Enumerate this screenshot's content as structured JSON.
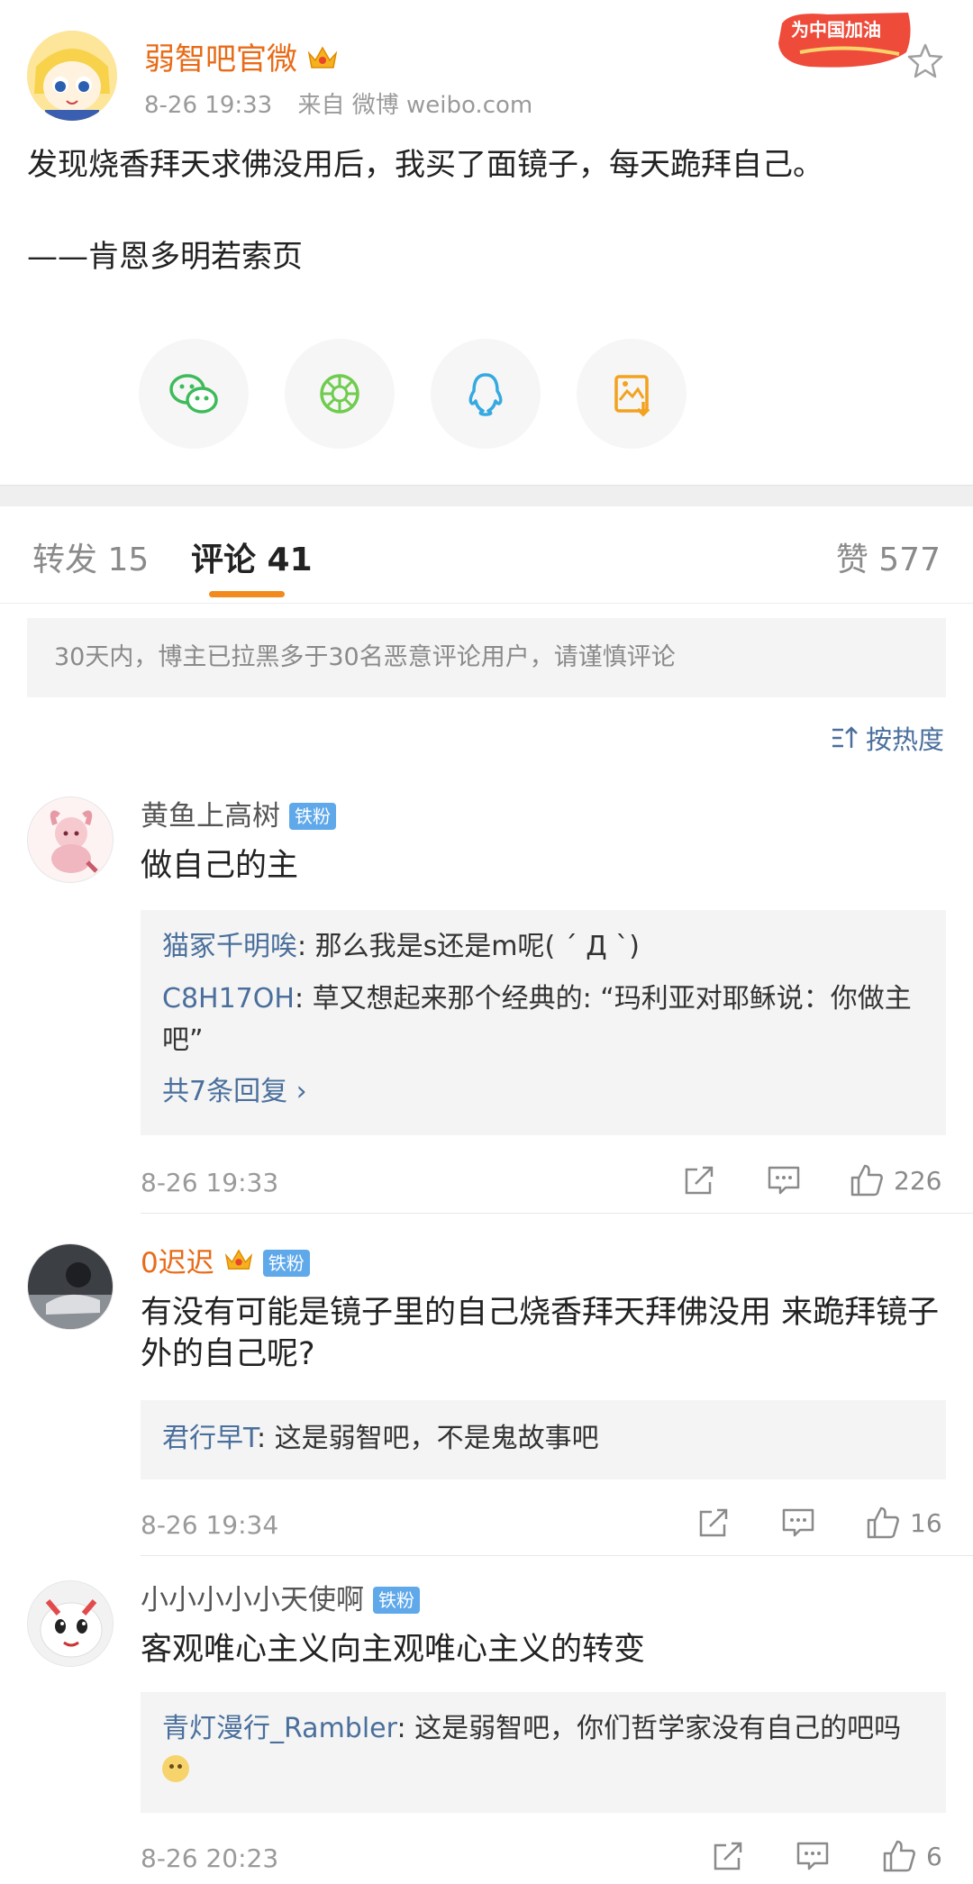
{
  "post": {
    "author": "弱智吧官微",
    "time": "8-26 19:33",
    "source": "来自 微博 weibo.com",
    "promo_text": "为中国加油",
    "text": "发现烧香拜天求佛没用后，我买了面镜子，每天跪拜自己。",
    "signature": "——肯恩多明若索页",
    "share_icons": [
      "wechat-icon",
      "moments-icon",
      "qq-icon",
      "save-image-icon"
    ]
  },
  "tabs": {
    "repost": "转发 15",
    "comment": "评论 41",
    "like": "赞 577"
  },
  "notice": "30天内，博主已拉黑多于30名恶意评论用户，请谨慎评论",
  "sort_label": "按热度",
  "comments": [
    {
      "name": "黄鱼上高树",
      "badge": "铁粉",
      "text": "做自己的主",
      "replies": [
        {
          "name": "猫冢千明唉",
          "text": ": 那么我是s还是m呢(  ´ Д `)"
        },
        {
          "name": "C8H17OH",
          "text": ": 草又想起来那个经典的: “玛利亚对耶稣说：你做主吧”"
        }
      ],
      "more": "共7条回复 ›",
      "time": "8-26 19:33",
      "likes": "226"
    },
    {
      "name": "0迟迟",
      "badge": "铁粉",
      "text": "有没有可能是镜子里的自己烧香拜天拜佛没用 来跪拜镜子外的自己呢?",
      "replies": [
        {
          "name": "君行早T",
          "text": ": 这是弱智吧，不是鬼故事吧"
        }
      ],
      "time": "8-26 19:34",
      "likes": "16"
    },
    {
      "name": "小小小小小天使啊",
      "badge": "铁粉",
      "text": "客观唯心主义向主观唯心主义的转变",
      "replies": [
        {
          "name": "青灯漫行_Rambler",
          "text": ": 这是弱智吧，你们哲学家没有自己的吧吗"
        }
      ],
      "time": "8-26 20:23",
      "likes": "6"
    }
  ],
  "colors": {
    "accent_orange": "#e86b18",
    "link_blue": "#4a6f9c",
    "badge_blue": "#5fa8ea"
  }
}
